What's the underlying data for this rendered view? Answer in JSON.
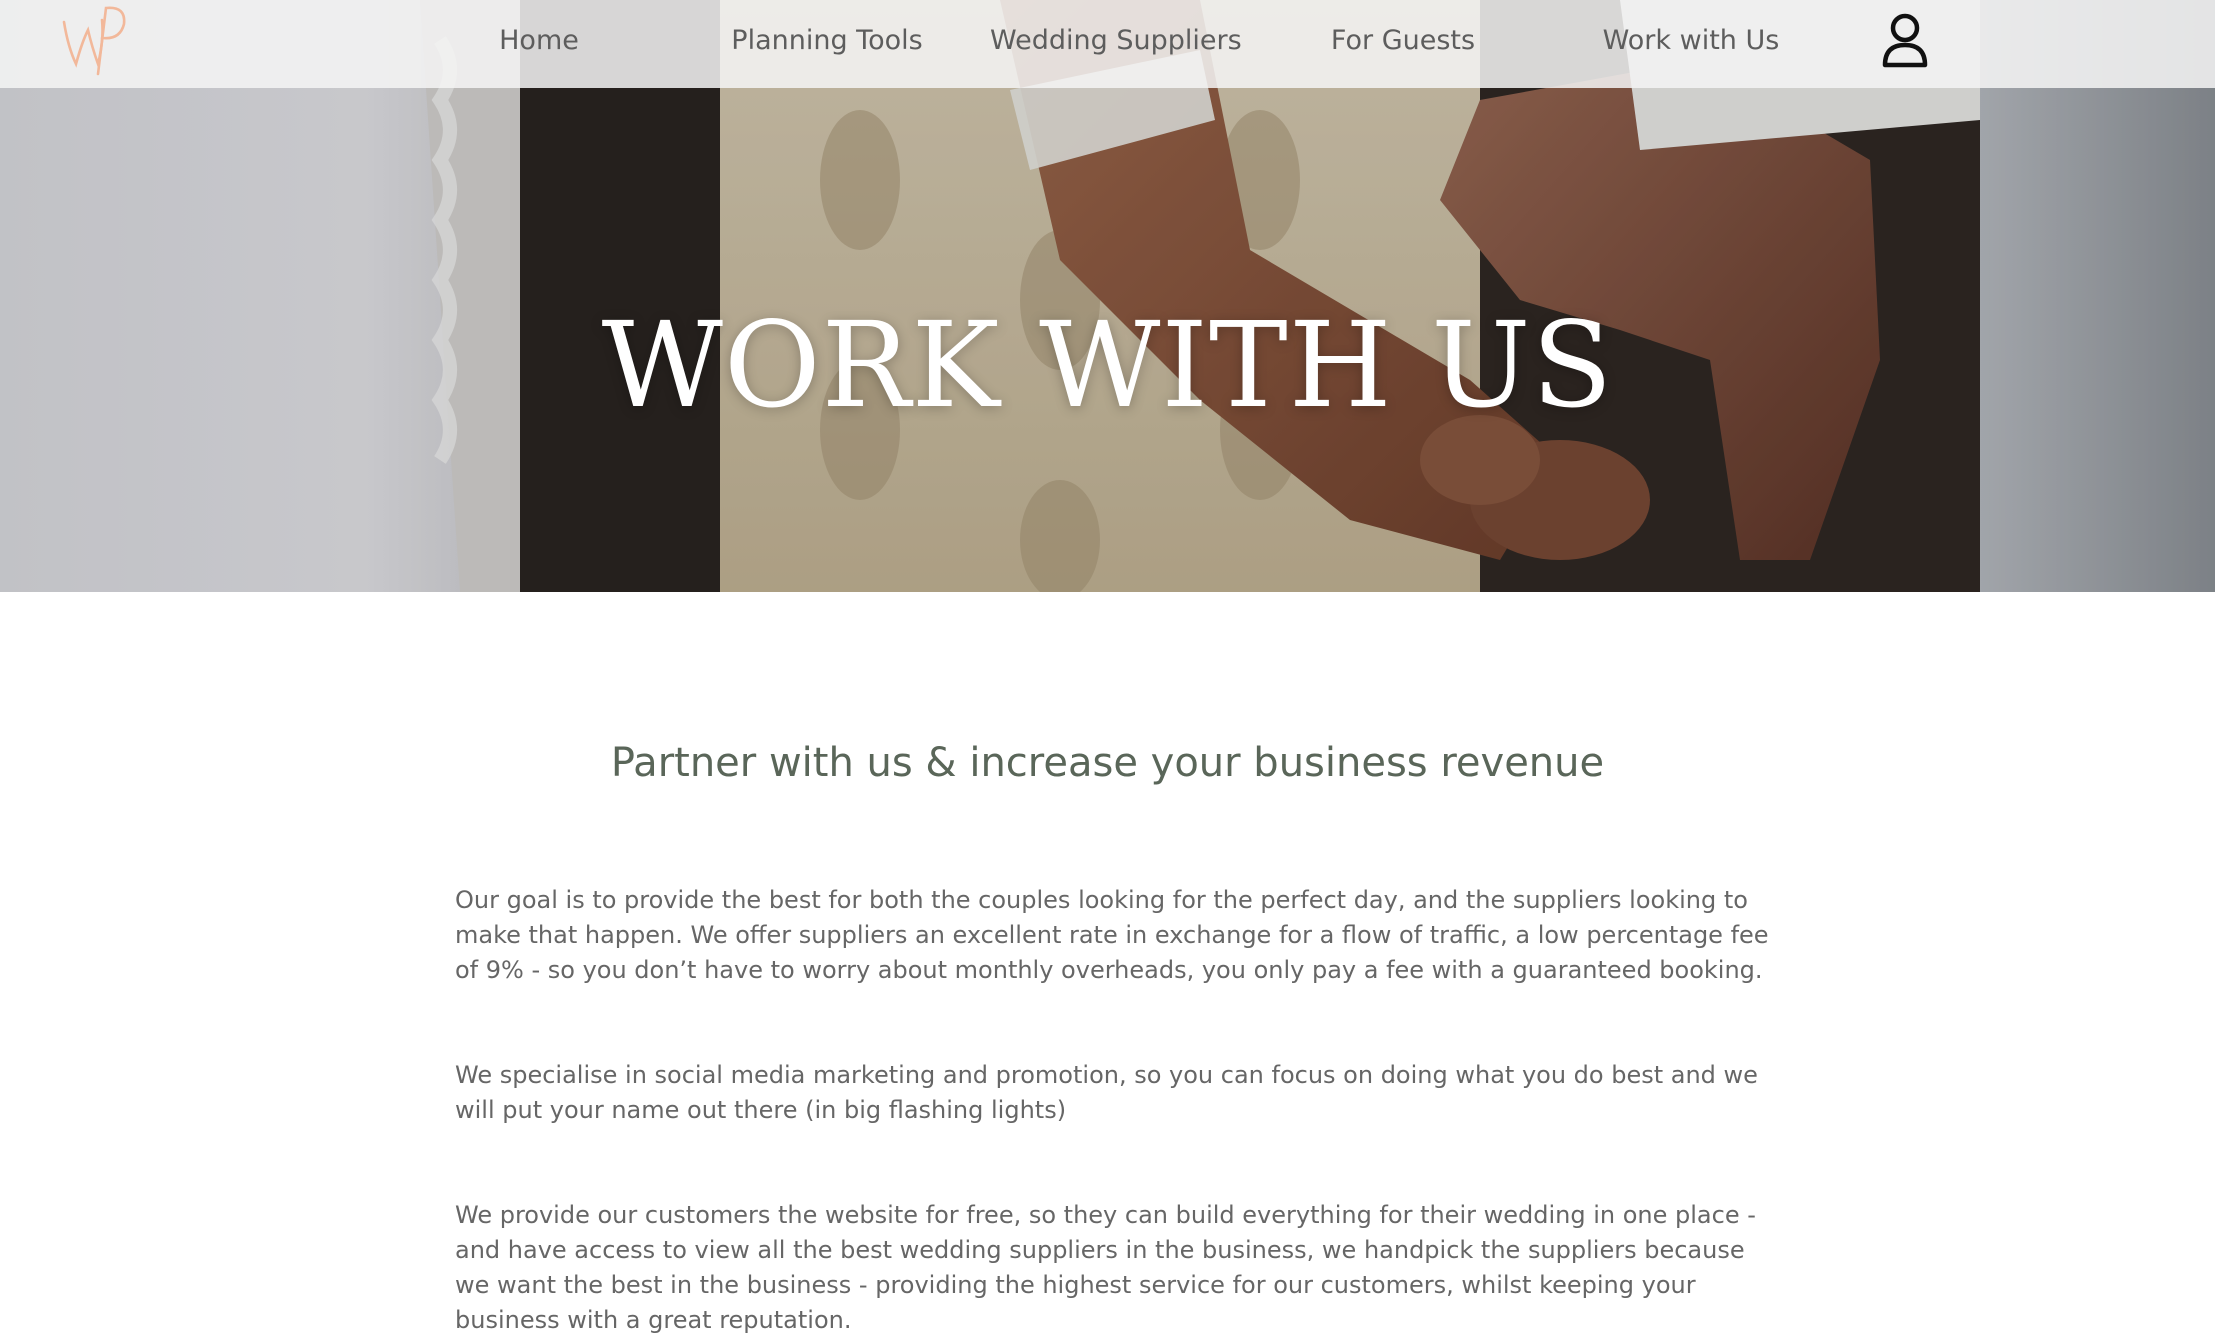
{
  "nav": {
    "logo_icon": "wp-monogram-logo",
    "items": [
      {
        "label": "Home"
      },
      {
        "label": "Planning Tools"
      },
      {
        "label": "Wedding Suppliers"
      },
      {
        "label": "For Guests"
      },
      {
        "label": "Work with Us"
      }
    ],
    "account_icon": "user-account-icon"
  },
  "hero": {
    "title": "WORK WITH US",
    "image": "couple-holding-hands-photo"
  },
  "content": {
    "heading": "Partner with us & increase your business revenue",
    "paragraphs": [
      "Our goal is to provide the best for both the couples looking for the perfect day, and the suppliers looking to make that happen. We offer suppliers an excellent rate in exchange for a flow of traffic, a low percentage fee of 9% - so you don’t have to worry about monthly overheads, you only pay a fee with a guaranteed booking.",
      "We specialise in social media marketing and promotion, so you can focus on doing what you do best and we will put your name out there (in big flashing lights)",
      "We provide our customers the website for free, so they can build everything for their wedding in one place - and have access to view all the best wedding suppliers in the business, we handpick the suppliers because we want the best in the business - providing the highest service for our customers, whilst keeping your business with a great reputation."
    ]
  },
  "colors": {
    "logo": "#f2b89a",
    "heading": "#5a6659",
    "body_text": "#666666",
    "nav_text": "#5d5d5d"
  }
}
